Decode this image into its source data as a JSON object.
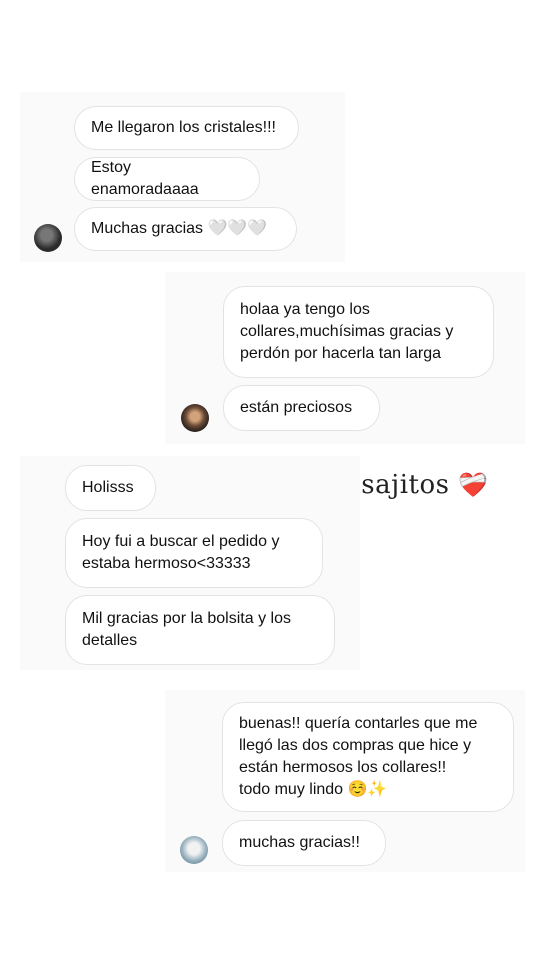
{
  "conversations": [
    {
      "messages": [
        "Me llegaron los cristales!!!",
        "Estoy enamoradaaaa",
        "Muchas gracias 🤍🤍🤍"
      ]
    },
    {
      "messages": [
        "holaa ya tengo los\ncollares,muchísimas gracias y\nperdón por hacerla tan larga",
        "están preciosos"
      ]
    },
    {
      "messages": [
        "Holisss",
        "Hoy fui a buscar el pedido y\nestaba hermoso<33333",
        "Mil gracias por la bolsita y los\ndetalles"
      ]
    },
    {
      "messages": [
        "buenas!! quería contarles que me\nllegó las dos compras que hice y\nestán hermosos los collares!!\ntodo muy lindo ☺️✨",
        "muchas gracias!!"
      ]
    }
  ],
  "title": {
    "text": "mensajitos",
    "emoji": "❤️‍🩹"
  },
  "colors": {
    "bubble_border": "#e3e3e3",
    "card_bg": "#fafafa"
  }
}
